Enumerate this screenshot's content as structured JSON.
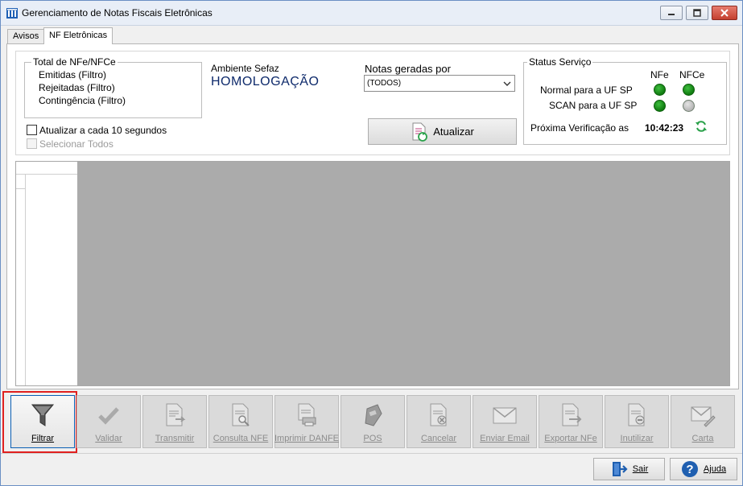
{
  "window": {
    "title": "Gerenciamento de Notas Fiscais Eletrônicas",
    "buttons": {
      "minimize": "minimize-icon",
      "maximize": "maximize-icon",
      "close": "close-icon"
    }
  },
  "tabs": [
    {
      "label": "Avisos",
      "active": false
    },
    {
      "label": "NF Eletrônicas",
      "active": true
    }
  ],
  "totals": {
    "legend": "Total de NFe/NFCe",
    "lines": [
      "Emitidas (Filtro)",
      "Rejeitadas (Filtro)",
      "Contingência (Filtro)"
    ]
  },
  "ambiente": {
    "label": "Ambiente Sefaz",
    "value": "HOMOLOGAÇÃO"
  },
  "notas": {
    "label": "Notas geradas por",
    "selected": "(TODOS)"
  },
  "atualizar_button": "Atualizar",
  "checkboxes": {
    "auto_refresh": {
      "label": "Atualizar a cada 10 segundos",
      "checked": false
    },
    "select_all": {
      "label": "Selecionar Todos",
      "checked": false,
      "disabled": true
    }
  },
  "status": {
    "legend": "Status Serviço",
    "col_nfe": "NFe",
    "col_nfce": "NFCe",
    "rows": [
      {
        "label": "Normal para a UF SP",
        "nfe": "on",
        "nfce": "on"
      },
      {
        "label": "SCAN para a UF SP",
        "nfe": "on",
        "nfce": "off"
      }
    ],
    "next_check_label": "Próxima Verificação as",
    "next_check_time": "10:42:23"
  },
  "toolbar": [
    {
      "label": "Filtrar",
      "icon": "filter-icon",
      "enabled": true
    },
    {
      "label": "Validar",
      "icon": "check-icon",
      "enabled": false
    },
    {
      "label": "Transmitir",
      "icon": "transmit-document-icon",
      "enabled": false
    },
    {
      "label": "Consulta NFE",
      "icon": "search-document-icon",
      "enabled": false
    },
    {
      "label": "Imprimir DANFE",
      "icon": "print-document-icon",
      "enabled": false
    },
    {
      "label": "POS",
      "icon": "pos-terminal-icon",
      "enabled": false
    },
    {
      "label": "Cancelar",
      "icon": "cancel-document-icon",
      "enabled": false
    },
    {
      "label": "Enviar Email",
      "icon": "email-icon",
      "enabled": false
    },
    {
      "label": "Exportar NFe",
      "icon": "export-document-icon",
      "enabled": false
    },
    {
      "label": "Inutilizar",
      "icon": "void-document-icon",
      "enabled": false
    },
    {
      "label": "Carta",
      "icon": "letter-icon",
      "enabled": false
    }
  ],
  "footer": {
    "sair": "Sair",
    "ajuda": "Ajuda"
  },
  "colors": {
    "status_green": "#1b8f1b",
    "highlight_red": "#e0201f",
    "accent_blue": "#0a5fb5"
  }
}
